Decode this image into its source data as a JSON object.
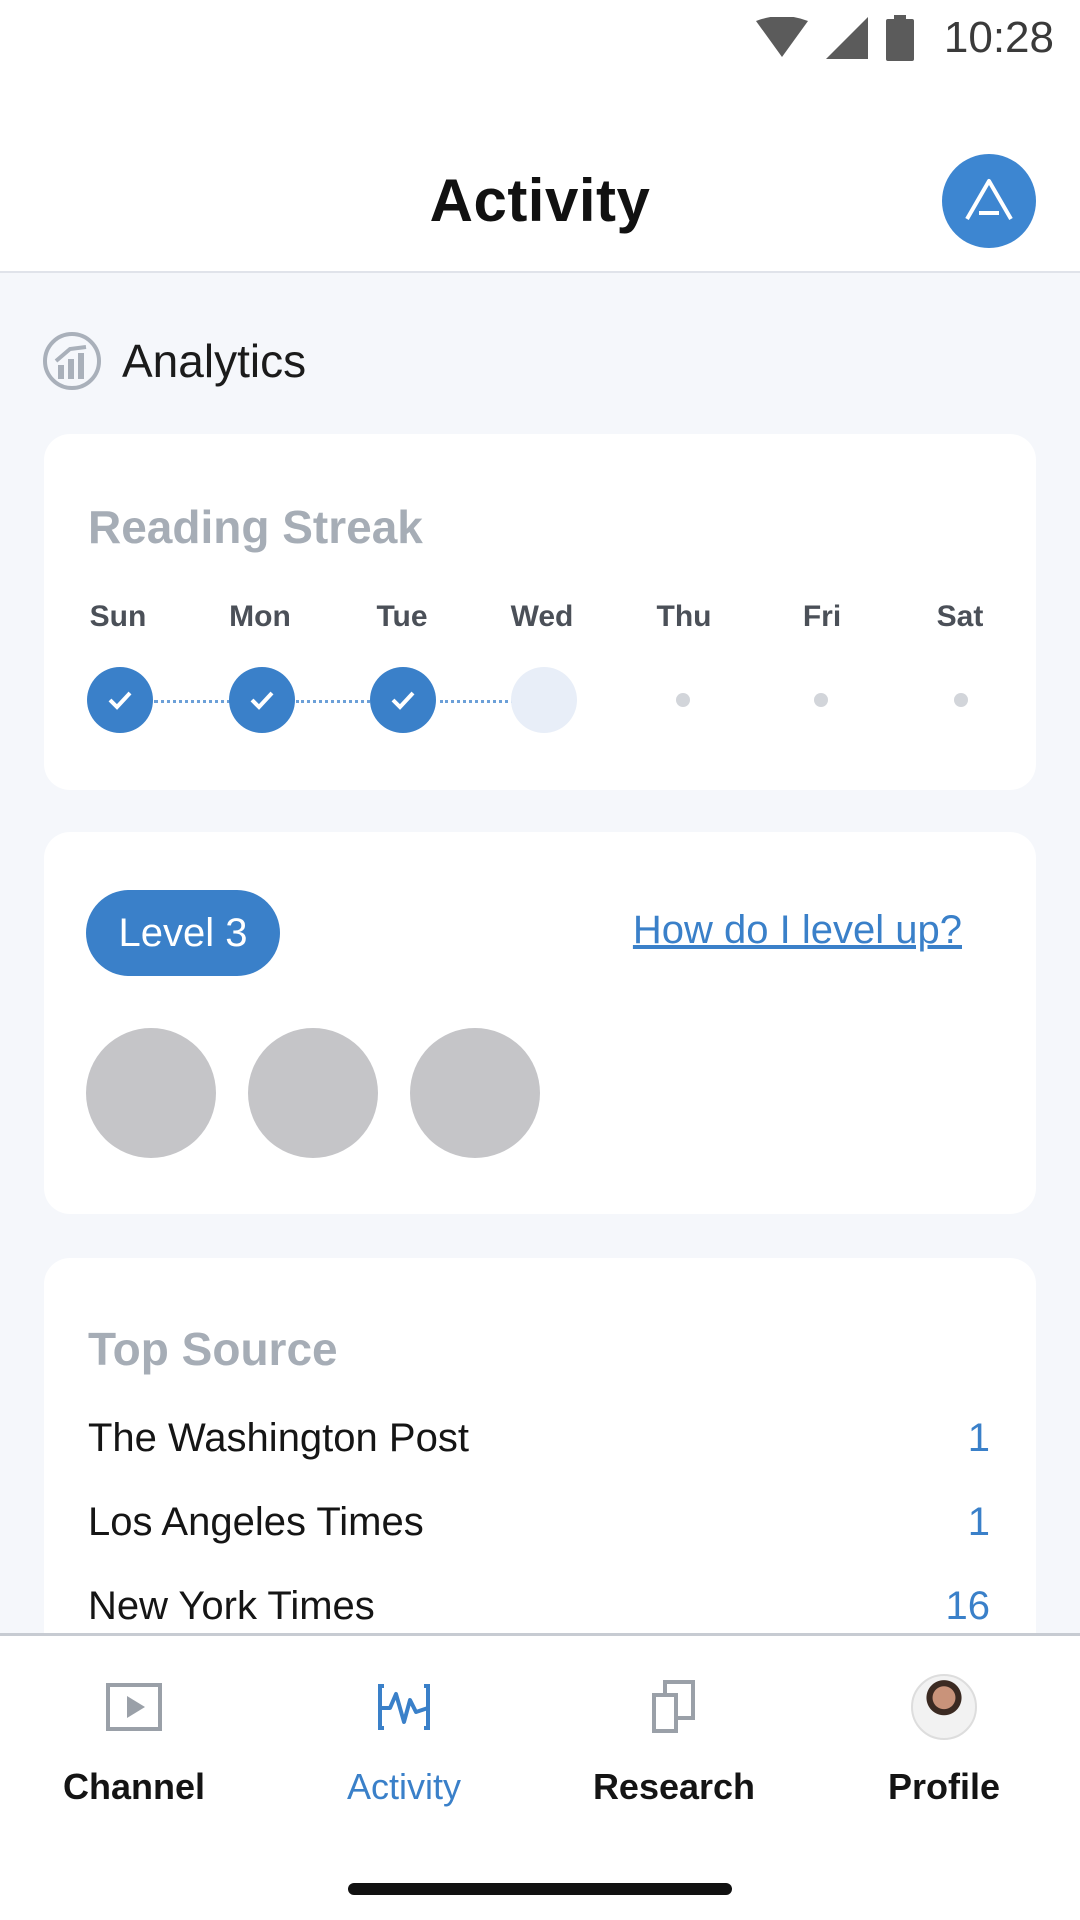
{
  "status_bar": {
    "time": "10:28"
  },
  "header": {
    "title": "Activity"
  },
  "analytics": {
    "title": "Analytics"
  },
  "reading_streak": {
    "title": "Reading Streak",
    "days": [
      {
        "label": "Sun",
        "state": "done"
      },
      {
        "label": "Mon",
        "state": "done"
      },
      {
        "label": "Tue",
        "state": "done"
      },
      {
        "label": "Wed",
        "state": "today"
      },
      {
        "label": "Thu",
        "state": "future"
      },
      {
        "label": "Fri",
        "state": "future"
      },
      {
        "label": "Sat",
        "state": "future"
      }
    ]
  },
  "level": {
    "badge": "Level 3",
    "link": "How do I level up?",
    "badges_count_displayed": 3
  },
  "top_source": {
    "title": "Top Source",
    "rows": [
      {
        "name": "The Washington Post",
        "count": "1"
      },
      {
        "name": "Los Angeles Times",
        "count": "1"
      },
      {
        "name": "New York Times",
        "count": "16"
      }
    ]
  },
  "nav": {
    "items": [
      {
        "label": "Channel",
        "icon": "play-icon"
      },
      {
        "label": "Activity",
        "icon": "activity-icon",
        "active": true
      },
      {
        "label": "Research",
        "icon": "copy-icon"
      },
      {
        "label": "Profile",
        "icon": "avatar"
      }
    ]
  },
  "colors": {
    "accent": "#3a80c9",
    "muted_title": "#a6adb6",
    "background": "#f5f7fb"
  }
}
